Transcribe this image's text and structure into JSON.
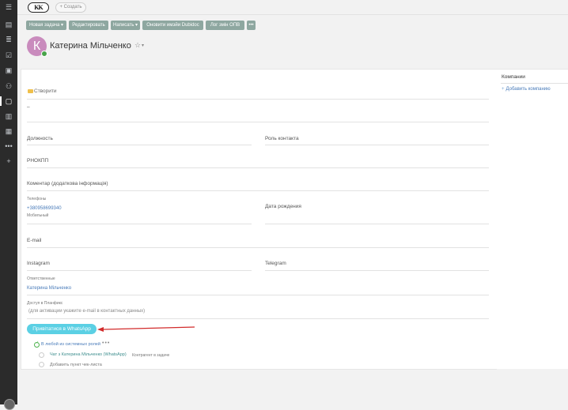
{
  "topbar": {
    "logo_text": "KK",
    "create_label": "+ Создать"
  },
  "toolbar": {
    "buttons": [
      "Новая задача ▾",
      "Редактировать",
      "Написать ▾",
      "Оновити имэйи Dubidoc",
      "Лог змін ОПВ",
      "•••"
    ]
  },
  "header": {
    "avatar_initial": "К",
    "name": "Катерина Мільченко",
    "star": "☆",
    "caret": "▾"
  },
  "form": {
    "create_link": "Створити",
    "dash_value": "–",
    "position_label": "Должность",
    "contact_role_label": "Роль контакта",
    "rnokpp_label": "РНОКПП",
    "comment_label": "Коментар (додаткова інформація)",
    "phones_label": "Телефоны",
    "phone_value": "+380958699340",
    "phone_type": "Мобильный",
    "birthday_label": "Дата рождения",
    "email_label": "E-mail",
    "instagram_label": "Instagram",
    "telegram_label": "Telegram",
    "responsible_label": "Ответственные",
    "responsible_value": "Катерина Мільченко",
    "access_label": "Доступ в Планфикс",
    "access_placeholder": "(для активации укажите e-mail в контактных данных)",
    "whatsapp_button": "Привітатися в WhatsApp"
  },
  "checklist": {
    "group_label": "В любой из системных ролей",
    "group_dots": "•••",
    "item1_label": "Чат з Катерина Мільченко (WhatsApp)",
    "item1_note": "Контрагент в задаче",
    "item2_label": "Добавить пункт чек-листа"
  },
  "side_panel": {
    "title": "Компании",
    "add_link": "Добавить компанию",
    "add_icon": "+"
  },
  "colors": {
    "sidebar_bg": "#2b2b2b",
    "toolbar_button": "#8ea7a0",
    "whatsapp_button": "#5bd0e4",
    "link": "#4a7cba",
    "arrow": "#d22b2b"
  }
}
